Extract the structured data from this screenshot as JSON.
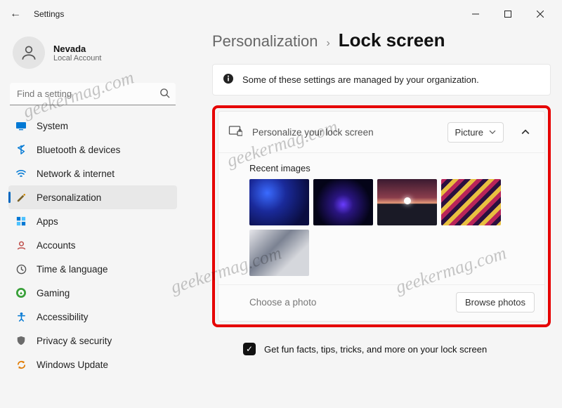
{
  "window": {
    "title": "Settings"
  },
  "user": {
    "name": "Nevada",
    "sub": "Local Account"
  },
  "search": {
    "placeholder": "Find a setting"
  },
  "nav": [
    {
      "key": "system",
      "label": "System"
    },
    {
      "key": "bluetooth",
      "label": "Bluetooth & devices"
    },
    {
      "key": "network",
      "label": "Network & internet"
    },
    {
      "key": "personalization",
      "label": "Personalization",
      "selected": true
    },
    {
      "key": "apps",
      "label": "Apps"
    },
    {
      "key": "accounts",
      "label": "Accounts"
    },
    {
      "key": "time",
      "label": "Time & language"
    },
    {
      "key": "gaming",
      "label": "Gaming"
    },
    {
      "key": "accessibility",
      "label": "Accessibility"
    },
    {
      "key": "privacy",
      "label": "Privacy & security"
    },
    {
      "key": "update",
      "label": "Windows Update"
    }
  ],
  "breadcrumb": {
    "parent": "Personalization",
    "current": "Lock screen"
  },
  "info": "Some of these settings are managed by your organization.",
  "lockscreen": {
    "title": "Personalize your lock screen",
    "mode": "Picture",
    "recent_label": "Recent images",
    "choose_label": "Choose a photo",
    "browse_label": "Browse photos"
  },
  "funfacts": {
    "checked": true,
    "label": "Get fun facts, tips, tricks, and more on your lock screen"
  },
  "watermark": "geekermag.com"
}
